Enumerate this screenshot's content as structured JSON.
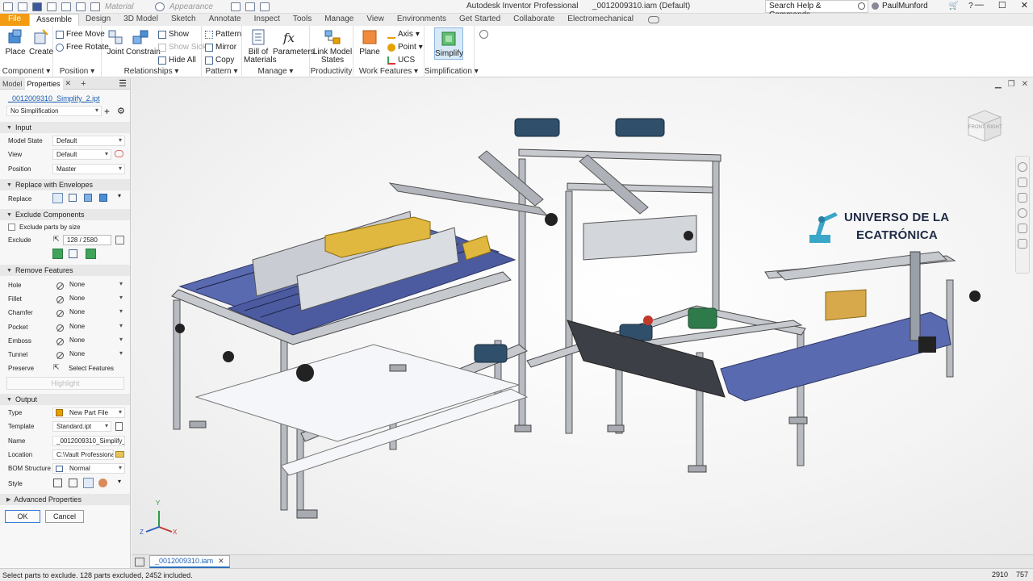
{
  "titlebar": {
    "material": "Material",
    "appearance": "Appearance",
    "app_title": "Autodesk Inventor Professional",
    "doc_title": "_0012009310.iam (Default)",
    "search_placeholder": "Search Help & Commands...",
    "user": "PaulMunford",
    "minimize": "—",
    "maximize": "☐",
    "close": "✕"
  },
  "tabs": [
    "File",
    "Assemble",
    "Design",
    "3D Model",
    "Sketch",
    "Annotate",
    "Inspect",
    "Tools",
    "Manage",
    "View",
    "Environments",
    "Get Started",
    "Collaborate",
    "Electromechanical"
  ],
  "active_tab": "Assemble",
  "ribbon": {
    "component": {
      "label": "Component",
      "place": "Place",
      "create": "Create"
    },
    "position": {
      "label": "Position",
      "free_move": "Free Move",
      "free_rotate": "Free Rotate"
    },
    "relationships": {
      "label": "Relationships",
      "joint": "Joint",
      "constrain": "Constrain",
      "show": "Show",
      "show_sick": "Show Sick",
      "hide_all": "Hide All"
    },
    "pattern": {
      "label": "Pattern",
      "pattern": "Pattern",
      "mirror": "Mirror",
      "copy": "Copy"
    },
    "manage": {
      "label": "Manage",
      "bom": "Bill of\nMaterials",
      "bom_l1": "Bill of",
      "bom_l2": "Materials",
      "parameters": "Parameters"
    },
    "productivity": {
      "label": "Productivity",
      "link_l1": "Link Model",
      "link_l2": "States"
    },
    "work_features": {
      "label": "Work Features",
      "plane": "Plane",
      "axis": "Axis",
      "point": "Point",
      "ucs": "UCS"
    },
    "simplification": {
      "label": "Simplification",
      "simplify": "Simplify"
    }
  },
  "panel": {
    "tab_model": "Model",
    "tab_properties": "Properties",
    "close": "✕",
    "add": "+",
    "menu": "☰",
    "filename": "_0012009310_Simplify_2.ipt",
    "simplification": "No Simplification",
    "sections": {
      "input": "Input",
      "replace_env": "Replace with Envelopes",
      "exclude_comp": "Exclude Components",
      "remove_feat": "Remove Features",
      "output": "Output",
      "advanced": "Advanced Properties"
    },
    "input": {
      "model_state_label": "Model State",
      "model_state": "Default",
      "view_label": "View",
      "view": "Default",
      "position_label": "Position",
      "position": "Master"
    },
    "replace_label": "Replace",
    "exclude_by_size": "Exclude parts by size",
    "exclude_label": "Exclude",
    "exclude_value": "128 / 2580",
    "features": [
      {
        "label": "Hole",
        "value": "None"
      },
      {
        "label": "Fillet",
        "value": "None"
      },
      {
        "label": "Chamfer",
        "value": "None"
      },
      {
        "label": "Pocket",
        "value": "None"
      },
      {
        "label": "Emboss",
        "value": "None"
      },
      {
        "label": "Tunnel",
        "value": "None"
      }
    ],
    "preserve_label": "Preserve",
    "preserve_value": "Select Features",
    "highlight": "Highlight",
    "output": {
      "type_label": "Type",
      "type": "New Part File",
      "template_label": "Template",
      "template": "Standard.ipt",
      "name_label": "Name",
      "name": "_0012009310_Simplify_2",
      "location_label": "Location",
      "location": "C:\\Vault Professional 2",
      "bom_label": "BOM Structure",
      "bom": "Normal",
      "style_label": "Style"
    },
    "ok": "OK",
    "cancel": "Cancel"
  },
  "viewport": {
    "cube_front": "FRONT",
    "cube_right": "RIGHT",
    "watermark_line1": "UNIVERSO DE LA",
    "watermark_line2": "ECATRÓNICA",
    "axis_x": "X",
    "axis_y": "Y",
    "axis_z": "Z"
  },
  "doc_tab": "_0012009310.iam",
  "status": {
    "message": "Select parts to exclude. 128 parts excluded, 2452 included.",
    "num1": "2910",
    "num2": "757"
  },
  "colors": {
    "file_tab": "#f39c12",
    "accent": "#2c6fbb",
    "machine_blue": "#5a6ab0",
    "gold": "#e0b840"
  }
}
